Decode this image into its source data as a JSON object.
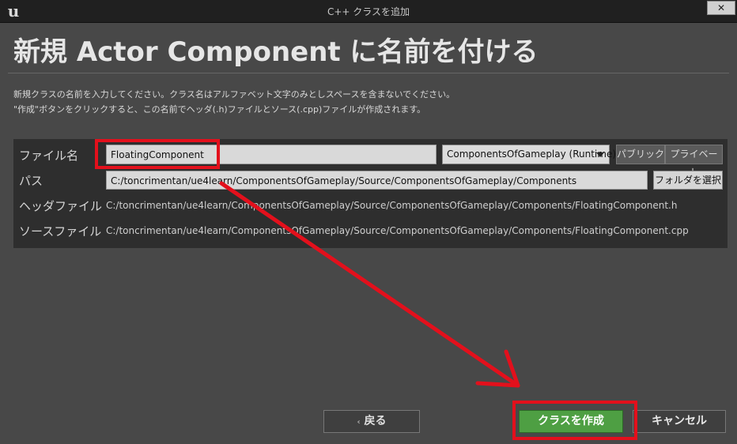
{
  "window": {
    "title": "C++ クラスを追加",
    "close_label": "✕"
  },
  "heading": "新規 Actor Component に名前を付ける",
  "description": {
    "line1": "新規クラスの名前を入力してください。クラス名はアルファベット文字のみとしスペースを含まないでください。",
    "line2": "\"作成\"ボタンをクリックすると、この名前でヘッダ(.h)ファイルとソース(.cpp)ファイルが作成されます。"
  },
  "form": {
    "file_name_label": "ファイル名",
    "file_name_value": "FloatingComponent",
    "module_value": "ComponentsOfGameplay (Runtime)",
    "public_label": "パブリック",
    "private_label": "プライベート",
    "path_label": "パス",
    "path_value": "C:/toncrimentan/ue4learn/ComponentsOfGameplay/Source/ComponentsOfGameplay/Components",
    "choose_folder_label": "フォルダを選択",
    "header_label": "ヘッダファイル",
    "header_value": "C:/toncrimentan/ue4learn/ComponentsOfGameplay/Source/ComponentsOfGameplay/Components/FloatingComponent.h",
    "source_label": "ソースファイル",
    "source_value": "C:/toncrimentan/ue4learn/ComponentsOfGameplay/Source/ComponentsOfGameplay/Components/FloatingComponent.cpp"
  },
  "footer": {
    "back_label": "戻る",
    "back_icon": "chevron-left-icon",
    "create_label": "クラスを作成",
    "cancel_label": "キャンセル"
  },
  "colors": {
    "accent_green": "#4e9f43",
    "annotation_red": "#e3101c"
  }
}
